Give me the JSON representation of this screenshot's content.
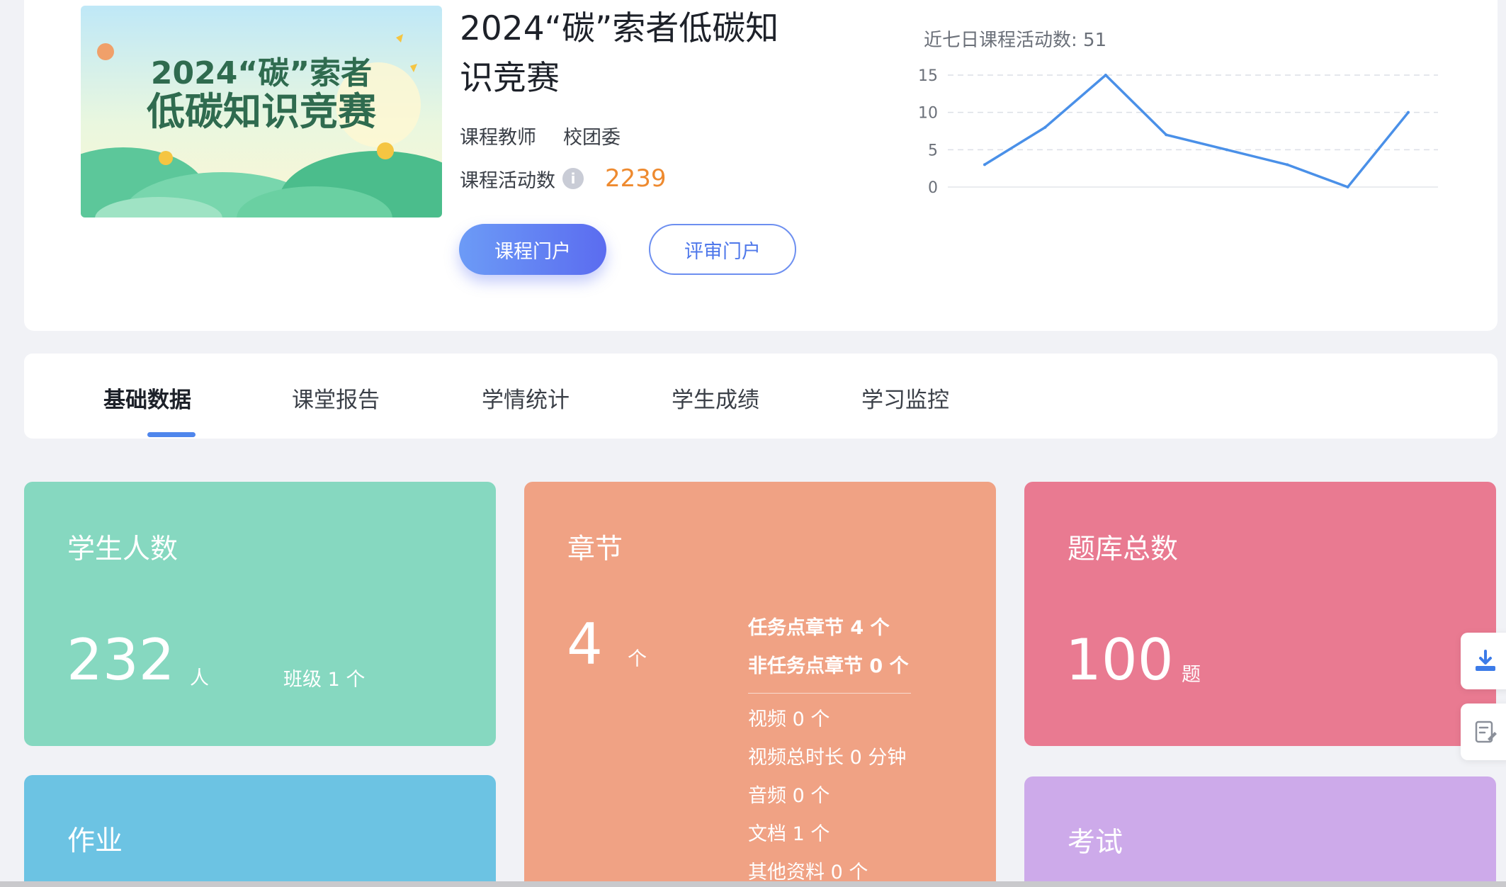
{
  "course": {
    "title": "2024“碳”索者低碳知识竞赛",
    "cover_text_line1": "2024“碳”索者",
    "cover_text_line2": "低碳知识竞赛",
    "teacher_label": "课程教师",
    "teacher_name": "校团委",
    "activity_label": "课程活动数",
    "activity_value": "2239",
    "portal_button": "课程门户",
    "review_button": "评审门户"
  },
  "activity_chart": {
    "title": "近七日课程活动数: 51"
  },
  "chart_data": {
    "type": "line",
    "title": "近七日课程活动数: 51",
    "x": [
      1,
      2,
      3,
      4,
      5,
      6,
      7,
      8
    ],
    "values": [
      3,
      8,
      15,
      7,
      5,
      3,
      0,
      10
    ],
    "y_ticks": [
      "0",
      "5",
      "10",
      "15"
    ],
    "ylim": [
      0,
      15
    ],
    "grid": true,
    "color": "#4a90e8"
  },
  "tabs": [
    {
      "label": "基础数据",
      "active": true
    },
    {
      "label": "课堂报告",
      "active": false
    },
    {
      "label": "学情统计",
      "active": false
    },
    {
      "label": "学生成绩",
      "active": false
    },
    {
      "label": "学习监控",
      "active": false
    }
  ],
  "cards": {
    "students": {
      "title": "学生人数",
      "value": "232",
      "unit": "人",
      "class_info": "班级 1 个",
      "color": "#86d8c0"
    },
    "chapters": {
      "title": "章节",
      "value": "4",
      "unit": "个",
      "task_chapters": "任务点章节 4 个",
      "non_task_chapters": "非任务点章节 0 个",
      "videos": "视频 0 个",
      "video_duration": "视频总时长 0 分钟",
      "audio": "音频 0 个",
      "documents": "文档 1 个",
      "other": "其他资料 0 个",
      "color": "#f0a284"
    },
    "question_bank": {
      "title": "题库总数",
      "value": "100",
      "unit": "题",
      "color": "#e97a91"
    },
    "homework": {
      "title": "作业",
      "color": "#6cc3e3"
    },
    "exam": {
      "title": "考试",
      "color": "#cdaaea"
    }
  },
  "side_buttons": {
    "download_icon": "download-icon",
    "note_icon": "edit-note-icon"
  }
}
